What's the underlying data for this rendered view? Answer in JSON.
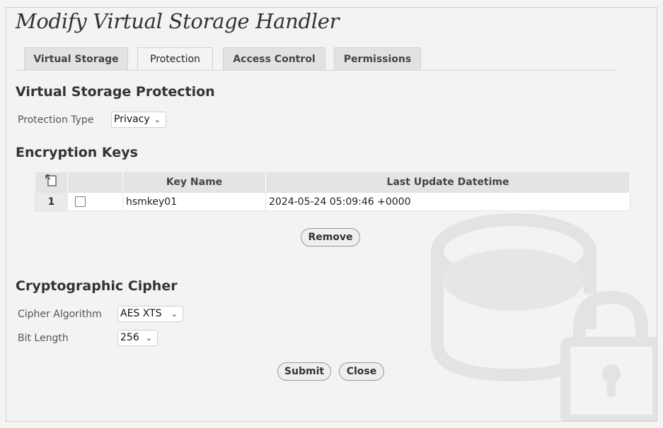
{
  "dialog": {
    "title": "Modify Virtual Storage Handler",
    "tabs": [
      {
        "label": "Virtual Storage",
        "active": false
      },
      {
        "label": "Protection",
        "active": true
      },
      {
        "label": "Access Control",
        "active": false
      },
      {
        "label": "Permissions",
        "active": false
      }
    ]
  },
  "protection": {
    "heading": "Virtual Storage Protection",
    "type_label": "Protection Type",
    "type_value": "Privacy"
  },
  "keys": {
    "heading": "Encryption Keys",
    "columns": [
      "Key Name",
      "Last Update Datetime"
    ],
    "rows": [
      {
        "num": "1",
        "checked": false,
        "key_name": "hsmkey01",
        "updated": "2024-05-24 05:09:46 +0000"
      }
    ],
    "remove_label": "Remove"
  },
  "cipher": {
    "heading": "Cryptographic Cipher",
    "algorithm_label": "Cipher Algorithm",
    "algorithm_value": "AES XTS",
    "bits_label": "Bit Length",
    "bits_value": "256"
  },
  "actions": {
    "submit_label": "Submit",
    "close_label": "Close"
  },
  "icons": {
    "watermark": "encrypted-storage-icon",
    "header": "column-chooser-icon",
    "dropdown": "chevron-down-icon"
  }
}
